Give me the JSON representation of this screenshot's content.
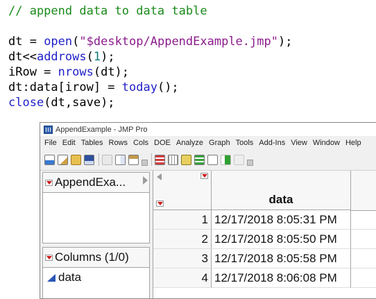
{
  "code": {
    "comment": "// append data to data table",
    "line1": {
      "var": "dt = ",
      "fn": "open",
      "open": "(",
      "str": "\"$desktop/AppendExample.jmp\"",
      "close": ");"
    },
    "line2": {
      "pre": "dt<<",
      "fn": "addrows",
      "open": "(",
      "num": "1",
      "close": ");"
    },
    "line3": {
      "pre": "iRow = ",
      "fn": "nrows",
      "rest": "(dt);"
    },
    "line4": {
      "pre": "dt:data[irow] = ",
      "fn": "today",
      "rest": "();"
    },
    "line5": {
      "fn": "close",
      "rest": "(dt,save);"
    }
  },
  "window": {
    "title": "AppendExample - JMP Pro",
    "menu": [
      "File",
      "Edit",
      "Tables",
      "Rows",
      "Cols",
      "DOE",
      "Analyze",
      "Graph",
      "Tools",
      "Add-Ins",
      "View",
      "Window",
      "Help"
    ],
    "toolbar_icons": [
      "new-data-table-icon",
      "new-script-icon",
      "open-icon",
      "save-icon",
      "cut-icon",
      "copy-icon",
      "paste-icon",
      "tables-icon",
      "data-grid-icon",
      "formula-icon",
      "stack-icon",
      "fx-icon",
      "run-icon",
      "edit-icon"
    ],
    "colors": {
      "red_triangle": "#d01818",
      "continuous_icon": "#2956b6"
    }
  },
  "table_panel": {
    "name": "AppendExa..."
  },
  "columns_panel": {
    "header": "Columns (1/0)",
    "columns": [
      "data"
    ]
  },
  "grid": {
    "column_header": "data",
    "rows": [
      {
        "num": "1",
        "value": "12/17/2018 8:05:31 PM"
      },
      {
        "num": "2",
        "value": "12/17/2018 8:05:50 PM"
      },
      {
        "num": "3",
        "value": "12/17/2018 8:05:58 PM"
      },
      {
        "num": "4",
        "value": "12/17/2018 8:06:08 PM"
      }
    ]
  }
}
